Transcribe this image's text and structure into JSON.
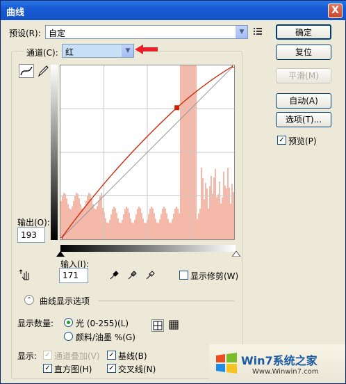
{
  "window": {
    "title": "曲线",
    "close_label": "X"
  },
  "preset": {
    "label": "预设(R):",
    "value": "自定"
  },
  "channel": {
    "label": "通道(C):",
    "value": "红"
  },
  "buttons": {
    "ok": "确定",
    "reset": "复位",
    "smooth": "平滑(M)",
    "auto": "自动(A)",
    "options": "选项(T)..."
  },
  "preview": {
    "label": "预览(P)",
    "checked": true
  },
  "output": {
    "label": "输出(O):",
    "value": "193"
  },
  "input": {
    "label": "输入(I):",
    "value": "171"
  },
  "show_clipping": {
    "label": "显示修剪(W)",
    "checked": false
  },
  "curve_options": {
    "label": "曲线显示选项"
  },
  "show_amount": {
    "label": "显示数量:",
    "light": "光 (0-255)(L)",
    "pigment": "颜料/油墨 %(G)",
    "selected": "light"
  },
  "display": {
    "label": "显示:",
    "channel_overlay": "通道叠加(V)",
    "baseline": "基线(B)",
    "histogram": "直方图(H)",
    "intersection": "交叉线(N)"
  },
  "watermark": {
    "brand": "Win7系统之家",
    "url": "Www.Winwin7.com"
  },
  "colors": {
    "accent": "#1553c5",
    "curve": "#cc2200",
    "histogram": "#f4b9a8",
    "arrow": "#e8202a"
  },
  "chart_data": {
    "type": "line",
    "curve_points": [
      [
        0,
        0
      ],
      [
        171,
        193
      ],
      [
        255,
        255
      ]
    ],
    "histogram_color": "#f4b9a8"
  }
}
